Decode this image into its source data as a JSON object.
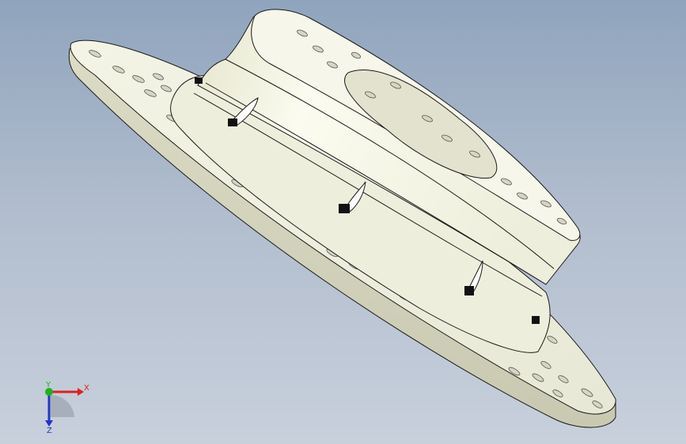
{
  "viewport": {
    "background_top": "#8fa4bd",
    "background_bottom": "#c8d0dc"
  },
  "model": {
    "part_color": "#f2f2e2",
    "edge_color": "#1a1a1a",
    "shade_color": "#d9d9c4",
    "marker_count": 4
  },
  "triad": {
    "x_label": "X",
    "y_label": "Y",
    "z_label": "Z",
    "x_color": "#e0201c",
    "y_color": "#1cb31c",
    "z_color": "#2333cc"
  }
}
